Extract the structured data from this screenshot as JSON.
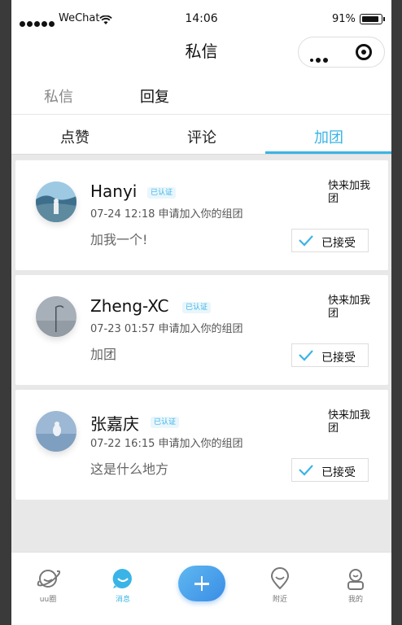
{
  "status_bar": {
    "carrier": "WeChat",
    "time": "14:06",
    "battery": "91%"
  },
  "navbar": {
    "title": "私信"
  },
  "top_tabs": [
    {
      "label": "私信"
    },
    {
      "label": "回复"
    }
  ],
  "sub_tabs": [
    {
      "label": "点赞"
    },
    {
      "label": "评论"
    },
    {
      "label": "加团"
    }
  ],
  "requests": [
    {
      "name": "Hanyi",
      "badge": "已认证",
      "meta": "07-24 12:18 申请加入你的组团",
      "message": "加我一个!",
      "group": "快来加我团",
      "status": "已接受"
    },
    {
      "name": "Zheng-XC",
      "badge": "已认证",
      "meta": "07-23 01:57 申请加入你的组团",
      "message": "加团",
      "group": "快来加我团",
      "status": "已接受"
    },
    {
      "name": "张嘉庆",
      "badge": "已认证",
      "meta": "07-22 16:15 申请加入你的组团",
      "message": "这是什么地方",
      "group": "快来加我团",
      "status": "已接受"
    }
  ],
  "tab_bar": [
    {
      "label": "uu圈",
      "icon": "planet-icon"
    },
    {
      "label": "消息",
      "icon": "message-icon"
    },
    {
      "label": "",
      "icon": "plus-icon"
    },
    {
      "label": "附近",
      "icon": "location-pin-icon"
    },
    {
      "label": "我的",
      "icon": "profile-icon"
    }
  ],
  "colors": {
    "accent": "#3ab4e6",
    "list_background": "#e8e8e8"
  }
}
